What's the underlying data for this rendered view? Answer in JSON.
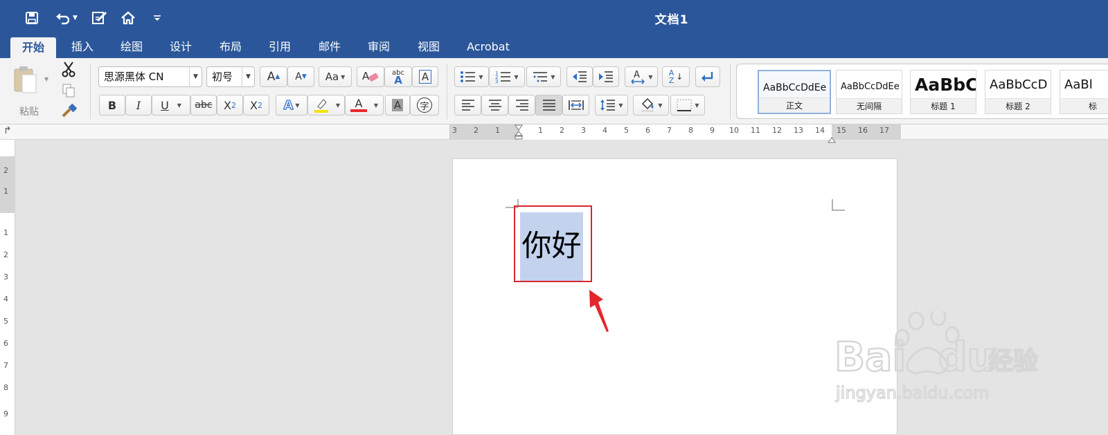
{
  "window": {
    "title": "文档1"
  },
  "quick_access": {
    "icons": [
      "save-icon",
      "undo-icon",
      "edit-doc-icon",
      "home-icon",
      "customize-arrow-icon"
    ]
  },
  "tabs": [
    {
      "label": "开始",
      "active": true
    },
    {
      "label": "插入"
    },
    {
      "label": "绘图"
    },
    {
      "label": "设计"
    },
    {
      "label": "布局"
    },
    {
      "label": "引用"
    },
    {
      "label": "邮件"
    },
    {
      "label": "审阅"
    },
    {
      "label": "视图"
    },
    {
      "label": "Acrobat"
    }
  ],
  "clipboard": {
    "paste_label": "粘贴"
  },
  "font": {
    "family": "思源黑体 CN",
    "size": "初号",
    "grow_label": "A",
    "shrink_label": "A",
    "case_label": "Aa",
    "phonetic_top": "abc",
    "phonetic_bottom": "A",
    "border_label": "A",
    "bold": "B",
    "italic": "I",
    "underline": "U",
    "strikethrough": "abc",
    "subscript_base": "X",
    "subscript_mark": "2",
    "superscript_base": "X",
    "superscript_mark": "2",
    "effects_label": "A",
    "color_label": "A",
    "shading_label": "A",
    "enclose_label": "字"
  },
  "paragraph": {
    "sort_top": "A",
    "sort_bottom": "Z"
  },
  "styles": [
    {
      "sample": "AaBbCcDdEe",
      "name": "正文",
      "selected": true
    },
    {
      "sample": "AaBbCcDdEe",
      "name": "无间隔"
    },
    {
      "sample": "AaBbC",
      "name": "标题 1"
    },
    {
      "sample": "AaBbCcD",
      "name": "标题 2"
    },
    {
      "sample": "AaBl",
      "name": "标"
    }
  ],
  "ruler": {
    "h_left": [
      "3",
      "2",
      "1"
    ],
    "h_right": [
      "1",
      "2",
      "3",
      "4",
      "5",
      "6",
      "7",
      "8",
      "9",
      "10",
      "11",
      "12",
      "13",
      "14",
      "15",
      "16",
      "17"
    ],
    "v_top": [
      "2",
      "1"
    ],
    "v_body": [
      "1",
      "2",
      "3",
      "4",
      "5",
      "6",
      "7",
      "8",
      "9"
    ]
  },
  "document": {
    "text": "你好"
  },
  "colors": {
    "title_bar": "#2b579a",
    "highlight_yellow": "#f5e400",
    "font_red": "#e8282b",
    "annotation_red": "#d8262d",
    "selection": "#c3d3ee"
  }
}
